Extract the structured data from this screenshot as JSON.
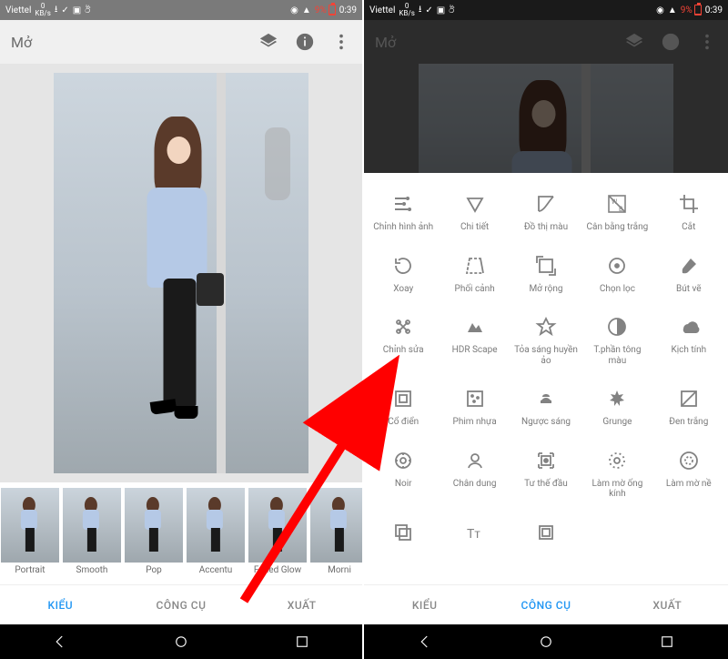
{
  "statusbar": {
    "carrier": "Viettel",
    "speed_top": "0",
    "speed_unit": "KB/s",
    "battery_pct": "9%",
    "time": "0:39"
  },
  "toolbar": {
    "title": "Mở",
    "layers_icon": "layers",
    "info_icon": "info",
    "menu_icon": "more"
  },
  "filters": [
    {
      "label": "Portrait"
    },
    {
      "label": "Smooth"
    },
    {
      "label": "Pop"
    },
    {
      "label": "Accentu"
    },
    {
      "label": "Faded Glow"
    },
    {
      "label": "Morni"
    }
  ],
  "nav": {
    "left": "KIỂU",
    "center": "CÔNG CỤ",
    "right": "XUẤT"
  },
  "tools": [
    {
      "label": "Chỉnh hình ảnh",
      "icon": "tune"
    },
    {
      "label": "Chi tiết",
      "icon": "triangle-down"
    },
    {
      "label": "Đồ thị màu",
      "icon": "curve"
    },
    {
      "label": "Cân bằng trắng",
      "icon": "wb"
    },
    {
      "label": "Cắt",
      "icon": "crop"
    },
    {
      "label": "Xoay",
      "icon": "rotate"
    },
    {
      "label": "Phối cảnh",
      "icon": "perspective"
    },
    {
      "label": "Mở rộng",
      "icon": "expand"
    },
    {
      "label": "Chọn lọc",
      "icon": "selective"
    },
    {
      "label": "Bút vẽ",
      "icon": "brush"
    },
    {
      "label": "Chỉnh sửa",
      "icon": "healing"
    },
    {
      "label": "HDR Scape",
      "icon": "hdr"
    },
    {
      "label": "Tỏa sáng huyền ảo",
      "icon": "glamour"
    },
    {
      "label": "T.phần tông màu",
      "icon": "tonal"
    },
    {
      "label": "Kịch tính",
      "icon": "drama"
    },
    {
      "label": "Cổ điển",
      "icon": "vintage"
    },
    {
      "label": "Phim nhựa",
      "icon": "grainy"
    },
    {
      "label": "Ngược sáng",
      "icon": "retrolux"
    },
    {
      "label": "Grunge",
      "icon": "grunge"
    },
    {
      "label": "Đen trắng",
      "icon": "bw"
    },
    {
      "label": "Noir",
      "icon": "noir"
    },
    {
      "label": "Chân dung",
      "icon": "portrait"
    },
    {
      "label": "Tư thế đầu",
      "icon": "headpose"
    },
    {
      "label": "Làm mờ ống kính",
      "icon": "lensblur"
    },
    {
      "label": "Làm mờ nề",
      "icon": "vignette"
    },
    {
      "label": "",
      "icon": "doubleexp"
    },
    {
      "label": "",
      "icon": "text"
    },
    {
      "label": "",
      "icon": "frames"
    }
  ]
}
